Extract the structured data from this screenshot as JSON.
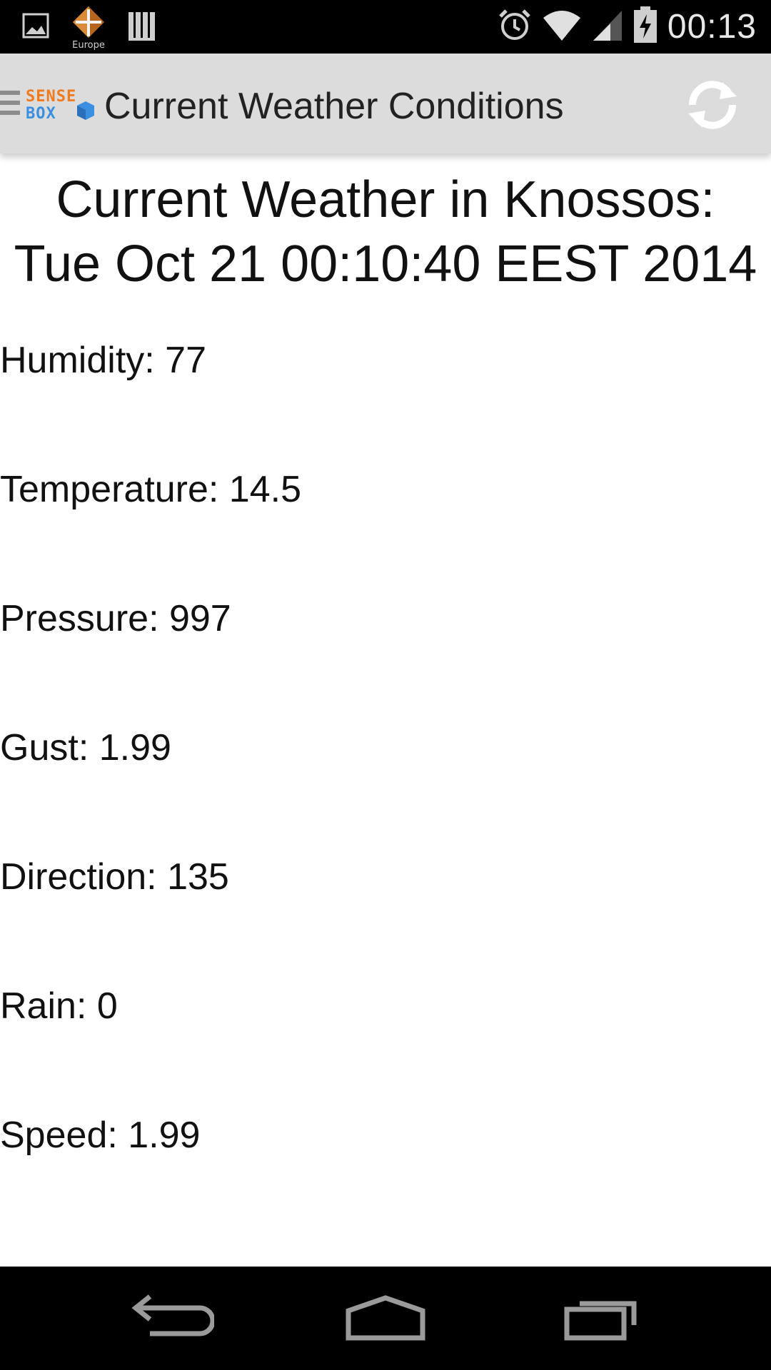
{
  "status_bar": {
    "time": "00:13",
    "carrier_badge": "Europe",
    "icons": [
      "image-icon",
      "europe-app-icon",
      "library-icon",
      "alarm-icon",
      "wifi-icon",
      "signal-icon",
      "battery-icon"
    ]
  },
  "action_bar": {
    "title": "Current Weather Conditions",
    "logo_text": [
      "SENSE",
      "BOX"
    ],
    "icons": [
      "menu-icon",
      "refresh-icon"
    ]
  },
  "main": {
    "heading_line1": "Current Weather in Knossos:",
    "heading_line2": "Tue Oct 21 00:10:40 EEST 2014",
    "readings": [
      "Humidity: 77",
      "Temperature: 14.5",
      "Pressure: 997",
      "Gust: 1.99",
      "Direction: 135",
      "Rain: 0",
      "Speed: 1.99"
    ]
  },
  "nav_bar": {
    "icons": [
      "back-icon",
      "home-icon",
      "recent-apps-icon"
    ]
  },
  "colors": {
    "status_bar_bg": "#000000",
    "action_bar_bg": "#dcdcdc",
    "logo_orange": "#f07a1e",
    "logo_blue": "#3b8fe0",
    "nav_icon": "#9a9a9a"
  }
}
